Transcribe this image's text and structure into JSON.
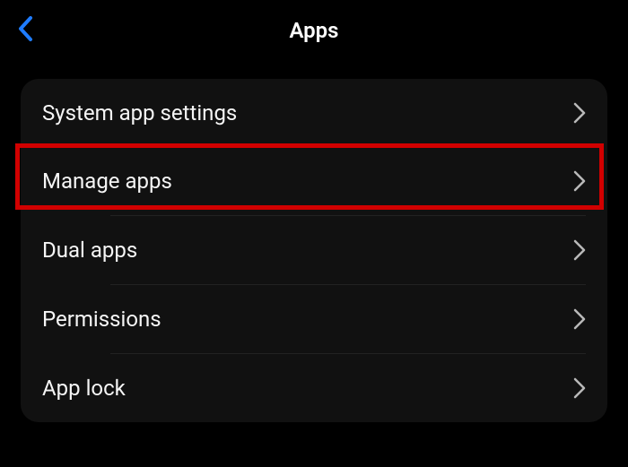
{
  "header": {
    "title": "Apps"
  },
  "rows": [
    {
      "label": "System app settings"
    },
    {
      "label": "Manage apps"
    },
    {
      "label": "Dual apps"
    },
    {
      "label": "Permissions"
    },
    {
      "label": "App lock"
    }
  ],
  "highlight": {
    "row_index": 1
  }
}
